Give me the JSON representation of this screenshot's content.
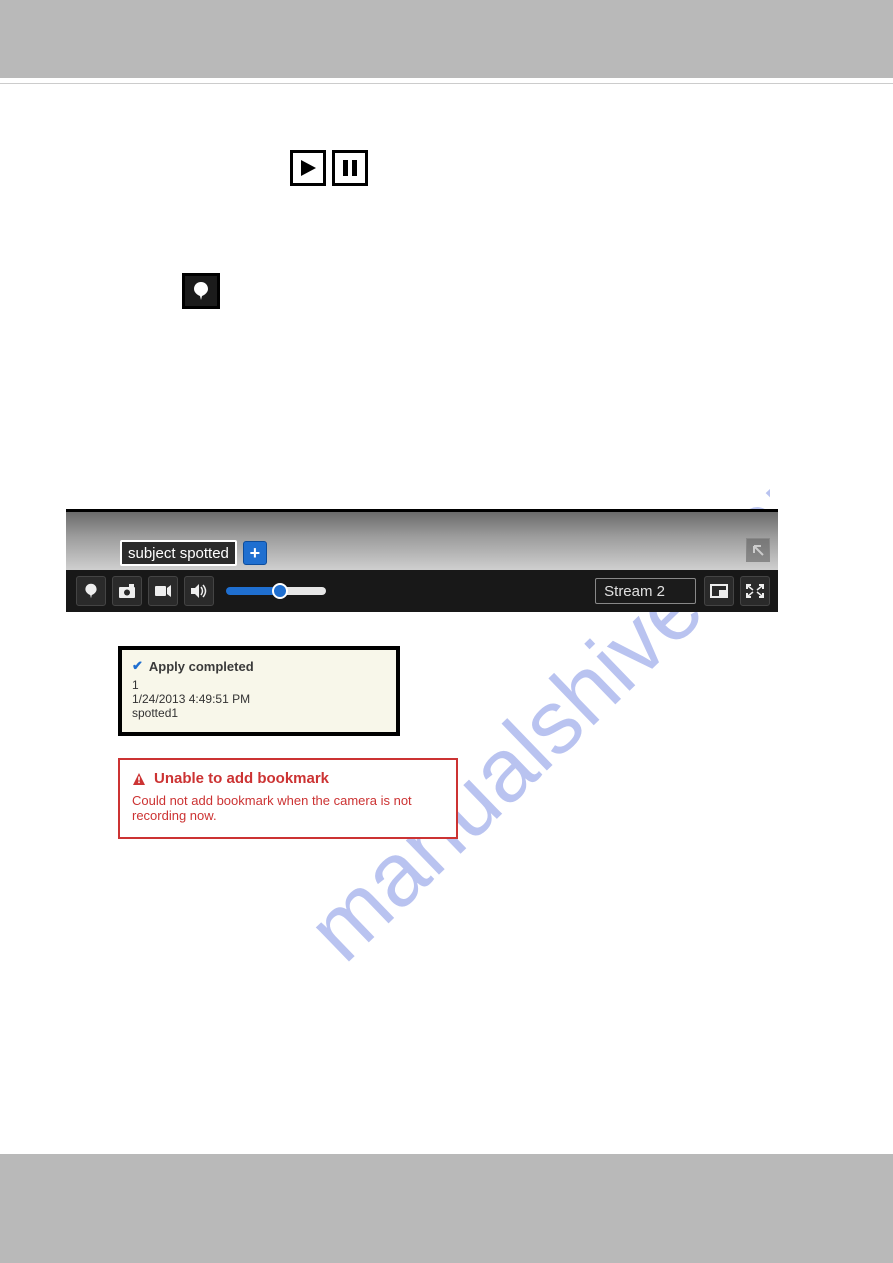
{
  "watermark_text": "manualshive.com",
  "player": {
    "label_input_value": "subject spotted",
    "add_button_label": "+",
    "stream_label": "Stream 2"
  },
  "apply_box": {
    "title": "Apply completed",
    "line1": "1",
    "line2": "1/24/2013 4:49:51 PM",
    "line3": "spotted1"
  },
  "error_box": {
    "title": "Unable to add bookmark",
    "body": "Could not add bookmark when the camera is not recording now."
  }
}
